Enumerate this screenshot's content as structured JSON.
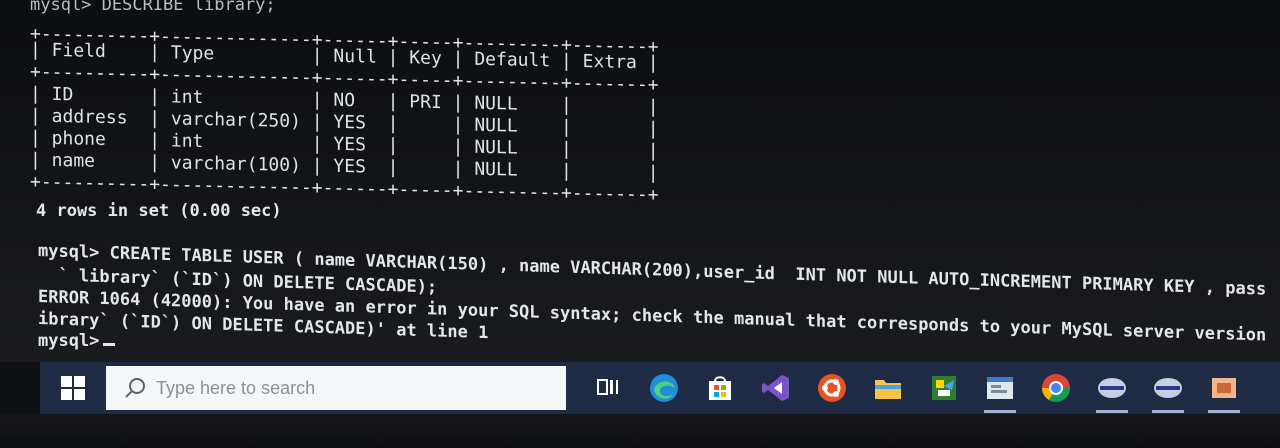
{
  "terminal": {
    "cmd_describe": "mysql> DESCRIBE library;",
    "table": {
      "border_top": "+----------+--------------+------+-----+---------+-------+",
      "header": "| Field    | Type         | Null | Key | Default | Extra |",
      "border_mid": "+----------+--------------+------+-----+---------+-------+",
      "rows": [
        "| ID       | int          | NO   | PRI | NULL    |       |",
        "| address  | varchar(250) | YES  |     | NULL    |       |",
        "| phone    | int          | YES  |     | NULL    |       |",
        "| name     | varchar(100) | YES  |     | NULL    |       |"
      ],
      "border_bottom": "+----------+--------------+------+-----+---------+-------+"
    },
    "rows_in_set": "4 rows in set (0.00 sec)",
    "create_cmd_line1": "mysql> CREATE TABLE USER ( name VARCHAR(150) , name VARCHAR(200),user_id  INT NOT NULL AUTO_INCREMENT PRIMARY KEY , pass",
    "create_cmd_line2": "  ` library` (`ID`) ON DELETE CASCADE);",
    "error_line1": "ERROR 1064 (42000): You have an error in your SQL syntax; check the manual that corresponds to your MySQL server version",
    "error_line2": "ibrary` (`ID`) ON DELETE CASCADE)' at line 1",
    "prompt": "mysql>"
  },
  "taskbar": {
    "search_placeholder": "Type here to search",
    "icons": [
      {
        "name": "task-view-icon"
      },
      {
        "name": "edge-icon"
      },
      {
        "name": "store-icon"
      },
      {
        "name": "visual-studio-icon"
      },
      {
        "name": "ubuntu-icon"
      },
      {
        "name": "file-explorer-icon"
      },
      {
        "name": "paint-icon"
      },
      {
        "name": "app-icon"
      },
      {
        "name": "chrome-icon"
      },
      {
        "name": "mysql-client-icon"
      },
      {
        "name": "mysql-client-icon-2"
      },
      {
        "name": "app-icon-2"
      }
    ]
  }
}
